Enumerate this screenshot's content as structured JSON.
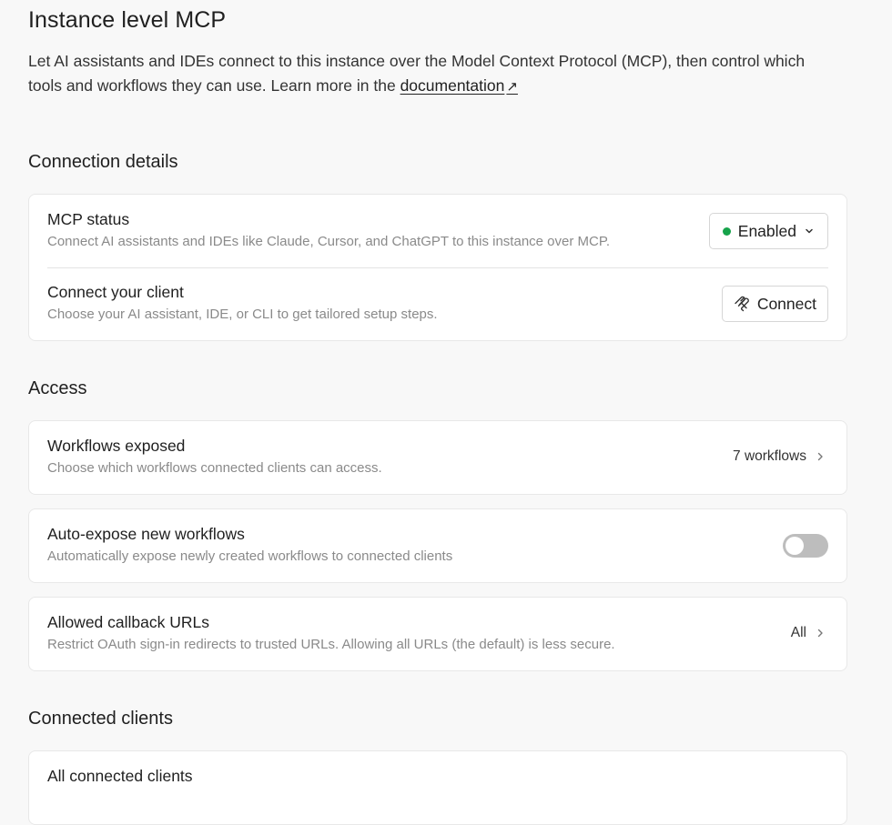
{
  "header": {
    "title": "Instance level MCP",
    "description": "Let AI assistants and IDEs connect to this instance over the Model Context Protocol (MCP), then control which tools and workflows they can use. Learn more in the ",
    "doc_link": "documentation",
    "ext_glyph": "↗"
  },
  "connection": {
    "section_title": "Connection details",
    "status": {
      "title": "MCP status",
      "subtitle": "Connect AI assistants and IDEs like Claude, Cursor, and ChatGPT to this instance over MCP.",
      "value": "Enabled",
      "status_color": "#16a34a"
    },
    "client": {
      "title": "Connect your client",
      "subtitle": "Choose your AI assistant, IDE, or CLI to get tailored setup steps.",
      "button": "Connect"
    }
  },
  "access": {
    "section_title": "Access",
    "workflows": {
      "title": "Workflows exposed",
      "subtitle": "Choose which workflows connected clients can access.",
      "value": "7 workflows"
    },
    "auto_expose": {
      "title": "Auto-expose new workflows",
      "subtitle": "Automatically expose newly created workflows to connected clients",
      "enabled": false
    },
    "callbacks": {
      "title": "Allowed callback URLs",
      "subtitle": "Restrict OAuth sign-in redirects to trusted URLs. Allowing all URLs (the default) is less secure.",
      "value": "All"
    }
  },
  "clients": {
    "section_title": "Connected clients",
    "all": {
      "title": "All connected clients"
    }
  },
  "icons": {
    "status_chevron": "chevron-down-icon",
    "connect": "mcp-logo-icon",
    "row_chevron": "chevron-right-icon"
  }
}
